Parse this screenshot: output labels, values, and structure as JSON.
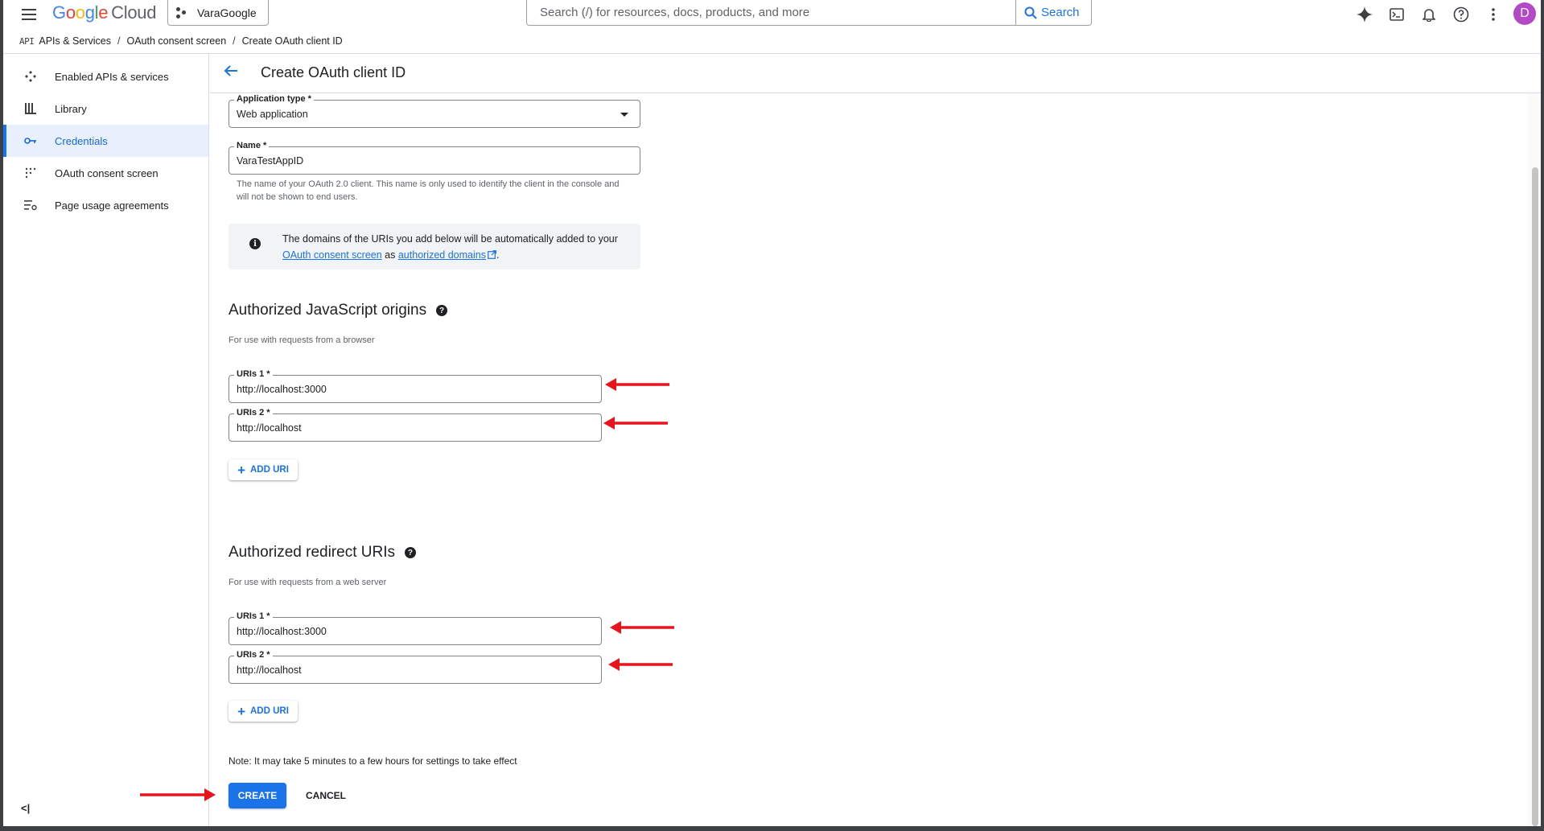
{
  "header": {
    "logo_google": "Google",
    "logo_cloud": "Cloud",
    "project_name": "VaraGoogle",
    "search_placeholder": "Search (/) for resources, docs, products, and more",
    "search_button": "Search",
    "avatar_initial": "D"
  },
  "breadcrumb": {
    "api_badge": "API",
    "items": [
      "APIs & Services",
      "OAuth consent screen",
      "Create OAuth client ID"
    ],
    "separator": "/"
  },
  "sidebar": {
    "items": [
      {
        "label": "Enabled APIs & services",
        "icon": "enabled-apis-icon"
      },
      {
        "label": "Library",
        "icon": "library-icon"
      },
      {
        "label": "Credentials",
        "icon": "key-icon",
        "active": true
      },
      {
        "label": "OAuth consent screen",
        "icon": "consent-screen-icon"
      },
      {
        "label": "Page usage agreements",
        "icon": "settings-list-icon"
      }
    ],
    "collapse_label": "<|"
  },
  "page": {
    "title": "Create OAuth client ID"
  },
  "form": {
    "app_type_label": "Application type *",
    "app_type_value": "Web application",
    "name_label": "Name *",
    "name_value": "VaraTestAppID",
    "name_helper": "The name of your OAuth 2.0 client. This name is only used to identify the client in the console and will not be shown to end users.",
    "info_prefix": "The domains of the URIs you add below will be automatically added to your",
    "info_link1": "OAuth consent screen",
    "info_mid": "as",
    "info_link2": "authorized domains",
    "info_suffix": "."
  },
  "js_origins": {
    "title": "Authorized JavaScript origins",
    "subtitle": "For use with requests from a browser",
    "uris": [
      {
        "label": "URIs 1 *",
        "value": "http://localhost:3000"
      },
      {
        "label": "URIs 2 *",
        "value": "http://localhost"
      }
    ],
    "add_label": "ADD URI"
  },
  "redirect_uris": {
    "title": "Authorized redirect URIs",
    "subtitle": "For use with requests from a web server",
    "uris": [
      {
        "label": "URIs 1 *",
        "value": "http://localhost:3000"
      },
      {
        "label": "URIs 2 *",
        "value": "http://localhost"
      }
    ],
    "add_label": "ADD URI"
  },
  "footer": {
    "note": "Note: It may take 5 minutes to a few hours for settings to take effect",
    "create_label": "CREATE",
    "cancel_label": "CANCEL"
  },
  "colors": {
    "accent": "#1a73e8",
    "annotation_arrow": "#e8141c",
    "avatar": "#b548c6"
  }
}
